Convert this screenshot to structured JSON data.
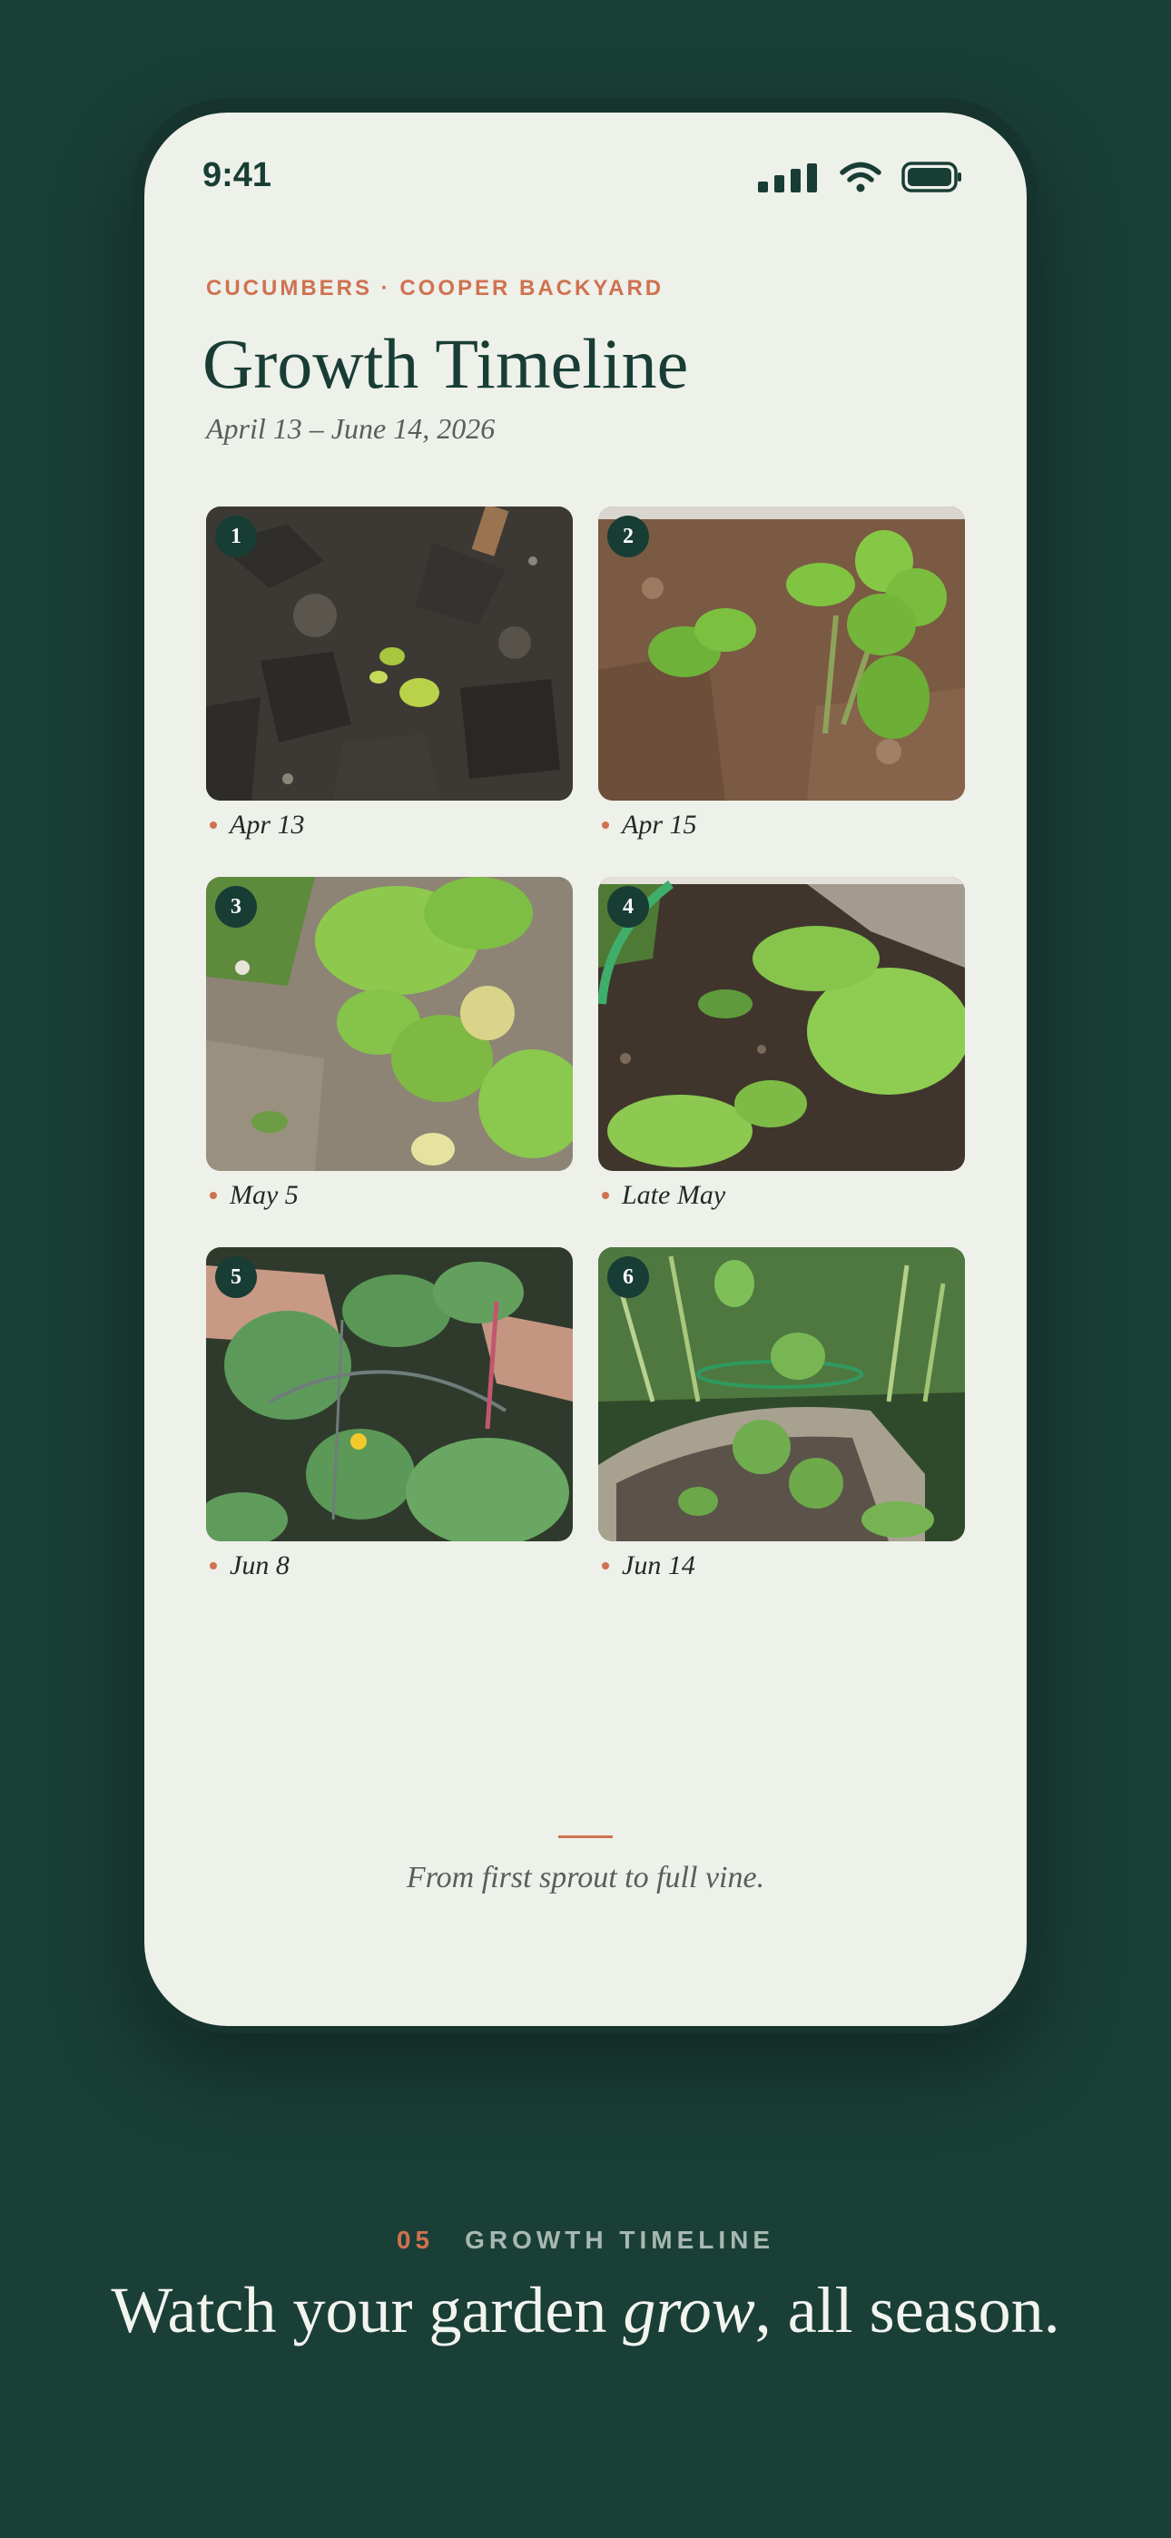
{
  "status_bar": {
    "time": "9:41"
  },
  "header": {
    "eyebrow": "CUCUMBERS · COOPER BACKYARD",
    "title": "Growth Timeline",
    "date_range": "April 13 – June 14, 2026"
  },
  "timeline": [
    {
      "step": "1",
      "date": "Apr 13",
      "photo": "cucumber-sprout-emerging-photo"
    },
    {
      "step": "2",
      "date": "Apr 15",
      "photo": "cucumber-seedling-photo"
    },
    {
      "step": "3",
      "date": "May 5",
      "photo": "cucumber-young-plant-photo"
    },
    {
      "step": "4",
      "date": "Late May",
      "photo": "cucumber-large-leaves-photo"
    },
    {
      "step": "5",
      "date": "Jun 8",
      "photo": "cucumber-flowering-photo"
    },
    {
      "step": "6",
      "date": "Jun 14",
      "photo": "cucumber-vine-on-trellis-photo"
    }
  ],
  "footer": {
    "note": "From first sprout to full vine."
  },
  "section": {
    "number": "05",
    "name": "GROWTH TIMELINE"
  },
  "headline": {
    "before": "Watch your garden ",
    "emphasis": "grow",
    "after": ", all season."
  },
  "colors": {
    "background": "#1a3f37",
    "screen": "#eef0ea",
    "accent": "#cf7250",
    "primary": "#183d35"
  }
}
